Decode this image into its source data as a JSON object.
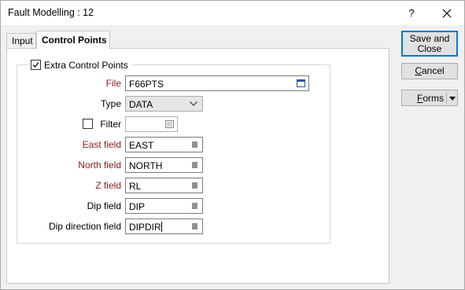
{
  "window": {
    "title": "Fault Modelling : 12",
    "help_label": "?"
  },
  "tabs": [
    {
      "label": "Input",
      "active": false
    },
    {
      "label": "Control Points",
      "active": true
    }
  ],
  "group": {
    "label": "Extra Control Points",
    "checked": true
  },
  "fields": {
    "file": {
      "label": "File",
      "value": "F66PTS",
      "required": true,
      "icon": "file-browse-icon"
    },
    "type": {
      "label": "Type",
      "value": "DATA",
      "required": false
    },
    "filter": {
      "label": "Filter",
      "value": "",
      "checked": false,
      "icon": "filter-list-icon"
    },
    "east": {
      "label": "East field",
      "value": "EAST",
      "required": true,
      "icon": "field-list-icon"
    },
    "north": {
      "label": "North field",
      "value": "NORTH",
      "required": true,
      "icon": "field-list-icon"
    },
    "z": {
      "label": "Z field",
      "value": "RL",
      "required": true,
      "icon": "field-list-icon"
    },
    "dip": {
      "label": "Dip field",
      "value": "DIP",
      "required": false,
      "icon": "field-list-icon"
    },
    "dipdir": {
      "label": "Dip direction field",
      "value": "DIPDIR",
      "required": false,
      "icon": "field-list-icon"
    }
  },
  "buttons": {
    "save_line1": "Save and",
    "save_line2": "Close",
    "cancel_pre": "",
    "cancel_ul": "C",
    "cancel_post": "ancel",
    "forms_pre": "",
    "forms_ul": "F",
    "forms_post": "orms"
  },
  "colors": {
    "required_label": "#8b1a1a",
    "focus_border": "#0078d7"
  }
}
